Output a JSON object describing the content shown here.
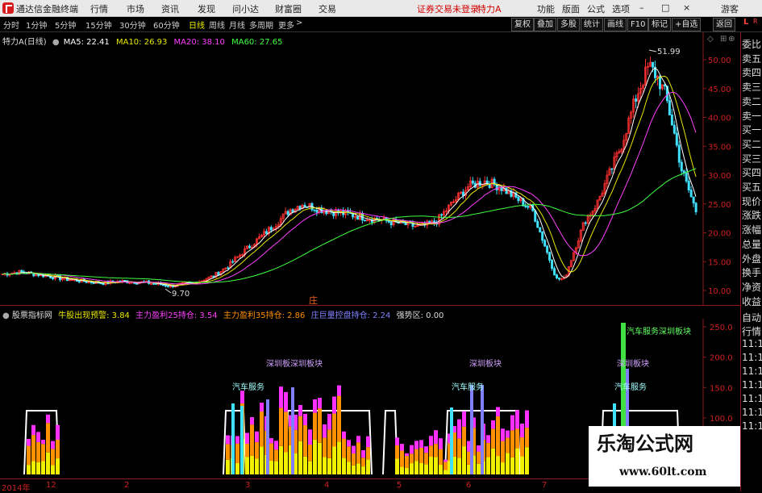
{
  "menu": {
    "app_title": "通达信金融终端",
    "items": [
      "行情",
      "市场",
      "资讯",
      "发现",
      "问小达",
      "财富圈",
      "交易"
    ],
    "status": "证券交易未登录",
    "stock_name": "特力A",
    "right_items": [
      "功能",
      "版面",
      "公式",
      "选项"
    ],
    "guest": "游客"
  },
  "period_bar": {
    "items": [
      "分时",
      "1分钟",
      "5分钟",
      "15分钟",
      "30分钟",
      "60分钟",
      "日线",
      "周线",
      "月线",
      "多周期",
      "更多"
    ],
    "active": "日线",
    "right_buttons": [
      "复权",
      "叠加",
      "多股",
      "统计",
      "画线",
      "F10",
      "标记",
      "+自选",
      "返回"
    ]
  },
  "main_chart": {
    "title": "特力A(日线)",
    "ma5_label": "MA5: 22.41",
    "ma10_label": "MA10: 26.93",
    "ma20_label": "MA20: 38.10",
    "ma60_label": "MA60: 27.65",
    "high_label": "51.99",
    "low_label": "9.70",
    "marker": "庄",
    "y_labels": [
      "50.00",
      "45.00",
      "40.00",
      "35.00",
      "30.00",
      "25.00",
      "20.00",
      "15.00",
      "10.00"
    ],
    "colors": {
      "ma5": "#ffffff",
      "ma10": "#e8e800",
      "ma20": "#ff40ff",
      "ma60": "#40ff40",
      "up": "#ff3030",
      "down": "#40e0ff"
    }
  },
  "indicator": {
    "name": "股票指标网",
    "l1": "牛股出现预警: 3.84",
    "l2": "主力盈利25持仓: 3.54",
    "l3": "主力盈利35持仓: 2.86",
    "l4": "庄巨量控盘持仓: 2.24",
    "l5": "强势区: 0.00",
    "annotations": [
      "深圳板深圳板块",
      "汽车服务",
      "深圳板块",
      "汽车服务",
      "深圳板块",
      "汽车服务",
      "汽车服务深圳板块"
    ],
    "y_labels": [
      "250.0",
      "200.0",
      "150.0",
      "100.0"
    ]
  },
  "x_axis": {
    "labels": [
      "2014年",
      "12",
      "2",
      "3",
      "4",
      "5",
      "6",
      "7"
    ]
  },
  "right_panel": {
    "items": [
      "委比",
      "卖五",
      "卖四",
      "卖三",
      "卖二",
      "卖一",
      "买一",
      "买二",
      "买三",
      "买四",
      "买五",
      "现价",
      "涨跌",
      "涨幅",
      "总量",
      "外盘",
      "换手",
      "净资",
      "收益"
    ],
    "lower_items": [
      "自动",
      "行情",
      "11:1",
      "11:1",
      "11:1",
      "11:1",
      "11:1",
      "11:1",
      "11:1"
    ],
    "tag_l": "L",
    "tag_r": "R"
  },
  "watermark": {
    "line1": "乐淘公式网",
    "line2": "www.60lt.com"
  }
}
